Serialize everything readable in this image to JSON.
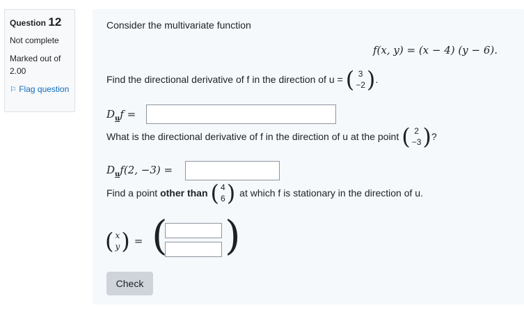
{
  "info": {
    "question_label": "Question",
    "question_number": "12",
    "state": "Not complete",
    "grade": "Marked out of 2.00",
    "flag": "Flag question"
  },
  "question": {
    "intro": "Consider the multivariate function",
    "function": "f(x, y) = (x − 4) (y − 6).",
    "part1": "Find the directional derivative of f in the direction of u =",
    "u_vector": [
      "3",
      "−2"
    ],
    "deriv_label": "D",
    "deriv_sub": "u",
    "deriv_rest": "f =",
    "part2": "What is the directional derivative of f in the direction of u at the point",
    "point_vector": [
      "2",
      "−3"
    ],
    "part2_end": "?",
    "deriv_point_rest": "f(2, −3) =",
    "part3_start": "Find a point",
    "part3_bold": "other than",
    "other_vector": [
      "4",
      "6"
    ],
    "part3_end": "at which f is stationary in the direction of u.",
    "xy_vector": [
      "x",
      "y"
    ],
    "equals": "="
  },
  "answers": {
    "d1": "",
    "d2": "",
    "x": "",
    "y": ""
  },
  "check_button": "Check"
}
